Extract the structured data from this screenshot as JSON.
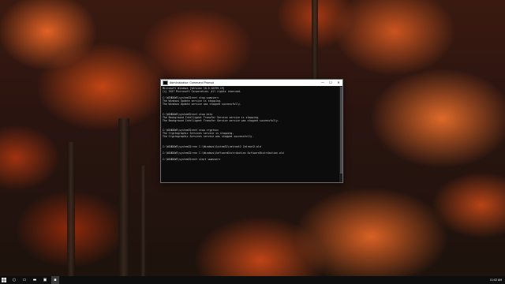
{
  "window": {
    "title": "Administrator: Command Prompt",
    "minimize": "—",
    "maximize": "☐",
    "close": "✕"
  },
  "console_lines": [
    "Microsoft Windows [Version 10.0.16299.19]",
    "(c) 2017 Microsoft Corporation. All rights reserved.",
    "",
    "C:\\WINDOWS\\system32>net stop wuauserv",
    "The Windows Update service is stopping.",
    "The Windows Update service was stopped successfully.",
    "",
    "",
    "C:\\WINDOWS\\system32>net stop bits",
    "The Background Intelligent Transfer Service service is stopping.",
    "The Background Intelligent Transfer Service service was stopped successfully.",
    "",
    "",
    "C:\\WINDOWS\\system32>net stop cryptsvc",
    "The Cryptographic Services service is stopping.",
    "The Cryptographic Services service was stopped successfully.",
    "",
    "",
    "C:\\WINDOWS\\system32>ren C:\\Windows\\System32\\catroot2 Catroot2.old",
    "",
    "C:\\WINDOWS\\system32>ren C:\\Windows\\SoftwareDistribution SoftwareDistribution.old",
    "",
    "C:\\WINDOWS\\system32>net start wuauserv"
  ],
  "taskbar": {
    "start_icon": "windows-logo-icon",
    "items": [
      {
        "icon": "search-icon",
        "glyph": "○"
      },
      {
        "icon": "task-view-icon",
        "glyph": "▭"
      },
      {
        "icon": "file-explorer-icon",
        "glyph": "▬"
      },
      {
        "icon": "store-icon",
        "glyph": "▣"
      },
      {
        "icon": "command-prompt-icon",
        "glyph": "▪"
      }
    ],
    "time": "11:02 AM"
  }
}
